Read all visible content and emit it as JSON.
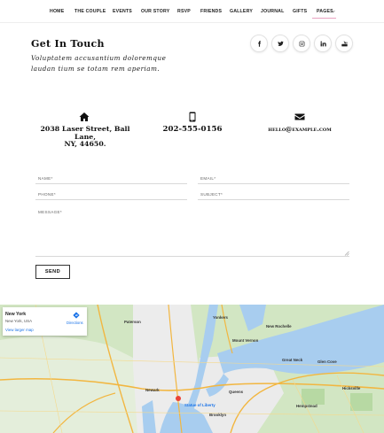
{
  "nav": {
    "items": [
      "HOME",
      "THE COUPLE",
      "EVENTS",
      "OUR STORY",
      "RSVP",
      "FRIENDS",
      "GALLERY",
      "JOURNAL",
      "GIFTS",
      "PAGES"
    ],
    "dropdown_icon": "chevron-down-icon"
  },
  "contact": {
    "title": "Get In Touch",
    "subtitle": "Voluptatem accusantium doloremque laudan tium se totam rem aperiam."
  },
  "social": {
    "icons": [
      "facebook-icon",
      "twitter-icon",
      "instagram-icon",
      "linkedin-icon",
      "youtube-icon"
    ]
  },
  "info": {
    "address": "2038 Laser Street, Ball Lane, NY, 44650.",
    "address_lines": [
      "2038 Laser Street, Ball",
      "Lane,",
      "NY, 44650."
    ],
    "phone": "202-555-0156",
    "email": "hello@example.com",
    "icons": [
      "home-icon",
      "mobile-phone-icon",
      "envelope-icon"
    ]
  },
  "form": {
    "name_label": "NAME*",
    "email_label": "EMAIL*",
    "phone_label": "PHONE*",
    "subject_label": "SUBJECT*",
    "message_label": "MESSAGE*",
    "send_label": "SEND"
  },
  "map": {
    "place_title": "New York",
    "place_subtitle": "New York, USA",
    "directions_label": "Directions",
    "larger_map_link": "View larger map",
    "labels": [
      "Paterson",
      "Yonkers",
      "New Rochelle",
      "Newark",
      "Statue of Liberty",
      "Brooklyn",
      "Queens",
      "Mount Vernon",
      "Great Neck",
      "Hempstead",
      "Glen Cove",
      "Hicksville"
    ],
    "colors": {
      "water": "#a8cdef",
      "land": "#d2e6c3",
      "urban": "#ececec",
      "roads": "#f5d98c",
      "highway": "#f2b640"
    }
  },
  "colors": {
    "accent": "#e8a3c1",
    "text": "#111111"
  }
}
